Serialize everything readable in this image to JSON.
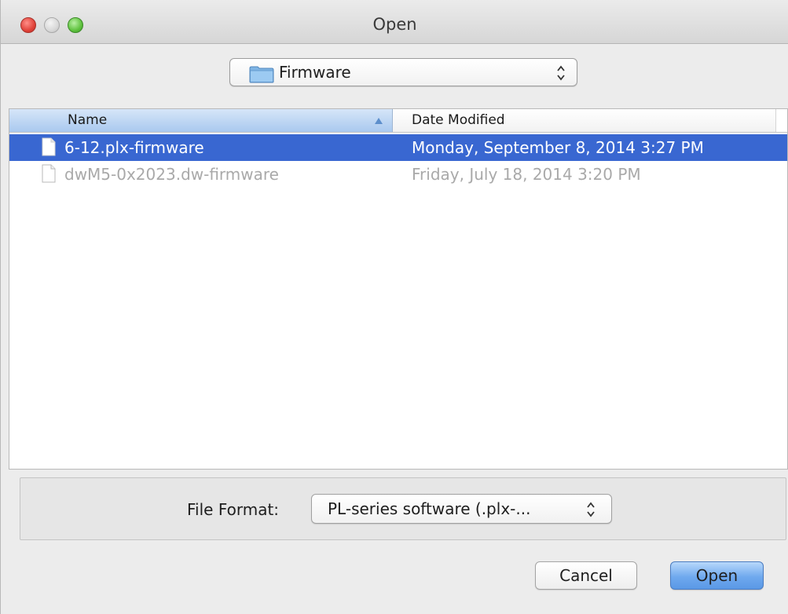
{
  "window": {
    "title": "Open"
  },
  "location": {
    "folder": "Firmware"
  },
  "file_list": {
    "columns": {
      "name": "Name",
      "date_modified": "Date Modified"
    },
    "rows": [
      {
        "name": "6-12.plx-firmware",
        "date_modified": "Monday, September 8, 2014 3:27 PM",
        "state": "selected"
      },
      {
        "name": "dwM5-0x2023.dw-firmware",
        "date_modified": "Friday, July 18, 2014 3:20 PM",
        "state": "disabled"
      }
    ]
  },
  "file_format": {
    "label": "File Format:",
    "selected": "PL-series software (.plx-..."
  },
  "buttons": {
    "cancel": "Cancel",
    "open": "Open"
  },
  "colors": {
    "selection": "#3967d1",
    "header_sorted": "#a9c9ef",
    "default_button": "#6fa9ee",
    "close_button": "#e1433a",
    "zoom_button": "#5fc23e"
  },
  "icons": {
    "close": "close-window-icon",
    "minimize": "minimize-window-icon",
    "zoom": "zoom-window-icon",
    "folder": "folder-icon",
    "document": "document-icon",
    "sort": "sort-ascending-icon",
    "popup": "up-down-chevron-icon"
  }
}
